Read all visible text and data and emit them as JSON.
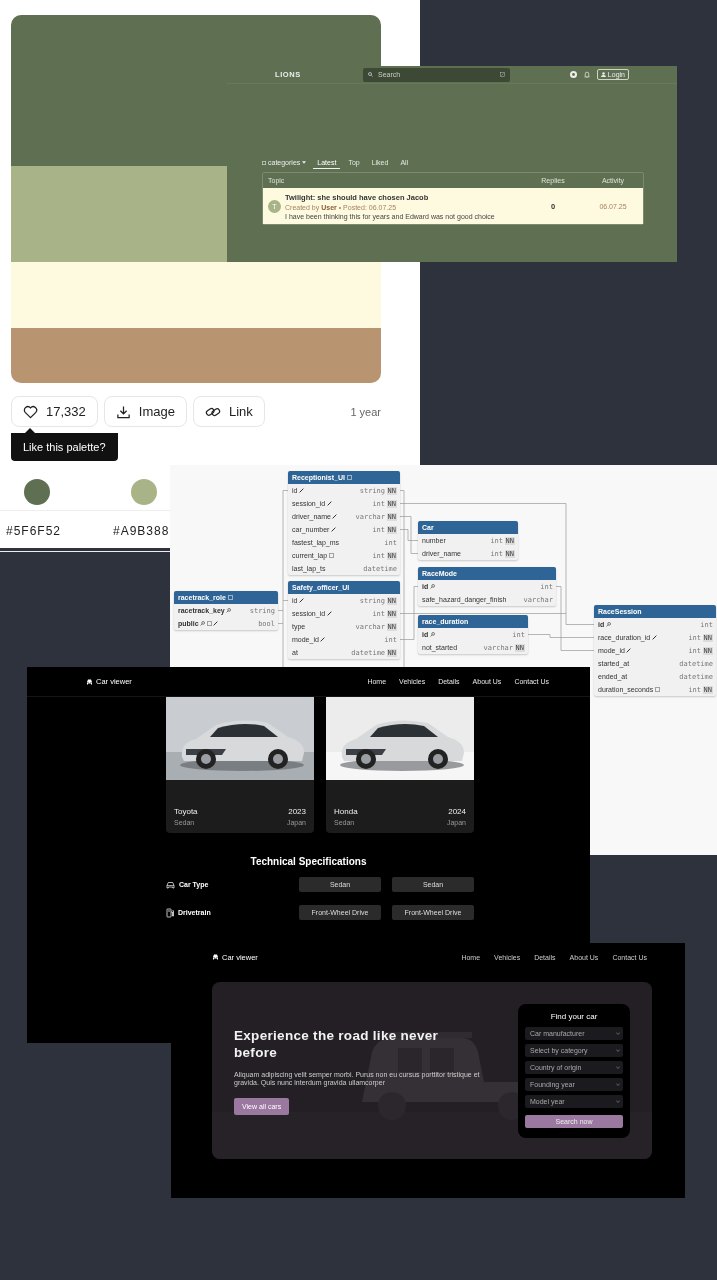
{
  "palette_card": {
    "swatches": [
      {
        "color": "#5F6F52"
      },
      {
        "color": "#A9B388"
      },
      {
        "color": "#FEFAE0"
      },
      {
        "color": "#B99470"
      }
    ],
    "like_count": "17,332",
    "buttons": [
      {
        "label": "Image",
        "kind": "download"
      },
      {
        "label": "Link",
        "kind": "link"
      }
    ],
    "age": "1 year",
    "tooltip": "Like this palette?",
    "colors": [
      {
        "color": "#5F6F52",
        "hex": "#5F6F52"
      },
      {
        "color": "#A9B388",
        "hex": "#A9B388"
      }
    ]
  },
  "forum": {
    "logo": "LIONS",
    "search_placeholder": "Search",
    "login": "Login",
    "categories": "categories",
    "tabs": [
      {
        "label": "Latest",
        "selected": true
      },
      {
        "label": "Top",
        "selected": false
      },
      {
        "label": "Liked",
        "selected": false
      },
      {
        "label": "All",
        "selected": false
      }
    ],
    "table": {
      "columns": [
        "Topic",
        "Replies",
        "Activity"
      ],
      "rows": [
        {
          "avatar": "T",
          "title": "Twilight: she should have chosen Jacob",
          "meta": "Created by **User** • Posted: 06.07.25",
          "excerpt": "I have been thinking this for years and Edward was not good choice",
          "replies": "0",
          "activity": "06.07.25"
        }
      ]
    }
  },
  "er_diagram": {
    "tables": [
      {
        "name": "Receptionist_UI",
        "kind": "noted",
        "fields": [
          {
            "name": "id",
            "type": "string",
            "constraint": "NN",
            "kind": "foreign"
          },
          {
            "name": "session_id",
            "type": "int",
            "constraint": "NN",
            "kind": "foreign"
          },
          {
            "name": "driver_name",
            "type": "varchar",
            "constraint": "NN",
            "kind": "foreign"
          },
          {
            "name": "car_number",
            "type": "int",
            "constraint": "NN",
            "kind": "foreign"
          },
          {
            "name": "fastest_lap_ms",
            "type": "int",
            "kind": "plain"
          },
          {
            "name": "current_lap",
            "type": "int",
            "constraint": "NN",
            "kind": "noted"
          },
          {
            "name": "last_lap_ts",
            "type": "datetime",
            "kind": "plain"
          }
        ]
      },
      {
        "name": "Car",
        "kind": "plain",
        "fields": [
          {
            "name": "number",
            "type": "int",
            "constraint": "NN",
            "kind": "plain"
          },
          {
            "name": "driver_name",
            "type": "int",
            "constraint": "NN",
            "kind": "plain"
          }
        ]
      },
      {
        "name": "racetrack_role",
        "kind": "noted",
        "fields": [
          {
            "name": "racetrack_key",
            "type": "string",
            "kind": "primary"
          },
          {
            "name": "public",
            "type": "bool",
            "kind": "primary-noted-foreign"
          }
        ]
      },
      {
        "name": "Safety_officer_UI",
        "kind": "plain",
        "fields": [
          {
            "name": "id",
            "type": "string",
            "constraint": "NN",
            "kind": "foreign"
          },
          {
            "name": "session_id",
            "type": "int",
            "constraint": "NN",
            "kind": "foreign"
          },
          {
            "name": "type",
            "type": "varchar",
            "constraint": "NN",
            "kind": "plain"
          },
          {
            "name": "mode_id",
            "type": "int",
            "kind": "foreign"
          },
          {
            "name": "at",
            "type": "datetime",
            "constraint": "NN",
            "kind": "plain"
          }
        ]
      },
      {
        "name": "RaceMode",
        "kind": "plain",
        "fields": [
          {
            "name": "id",
            "type": "int",
            "kind": "primary"
          },
          {
            "name": "safe_hazard_danger_finish",
            "type": "varchar",
            "kind": "plain"
          }
        ]
      },
      {
        "name": "race_duration",
        "kind": "plain",
        "fields": [
          {
            "name": "id",
            "type": "int",
            "kind": "primary"
          },
          {
            "name": "not_started",
            "type": "varchar",
            "constraint": "NN",
            "kind": "plain"
          }
        ]
      },
      {
        "name": "RaceSession",
        "kind": "plain",
        "fields": [
          {
            "name": "id",
            "type": "int",
            "kind": "primary"
          },
          {
            "name": "race_duration_id",
            "type": "int",
            "constraint": "NN",
            "kind": "foreign"
          },
          {
            "name": "mode_id",
            "type": "int",
            "constraint": "NN",
            "kind": "foreign"
          },
          {
            "name": "started_at",
            "type": "datetime",
            "kind": "plain"
          },
          {
            "name": "ended_at",
            "type": "datetime",
            "kind": "plain"
          },
          {
            "name": "duration_seconds",
            "type": "int",
            "constraint": "NN",
            "kind": "noted"
          }
        ]
      }
    ]
  },
  "car_viewer_details": {
    "brand": "Car viewer",
    "nav": [
      "Home",
      "Vehicles",
      "Details",
      "About Us",
      "Contact Us"
    ],
    "cars": [
      {
        "make": "Toyota",
        "year": "2023",
        "body": "Sedan",
        "country": "Japan"
      },
      {
        "make": "Honda",
        "year": "2024",
        "body": "Sedan",
        "country": "Japan"
      }
    ],
    "specs_title": "Technical Specifications",
    "specs": [
      {
        "label": "Car Type",
        "kind": "car",
        "values": [
          "Sedan",
          "Sedan"
        ]
      },
      {
        "label": "Drivetrain",
        "kind": "fuel",
        "values": [
          "Front-Wheel Drive",
          "Front-Wheel Drive"
        ]
      }
    ]
  },
  "car_viewer_home": {
    "brand": "Car viewer",
    "nav": [
      "Home",
      "Vehicles",
      "Details",
      "About Us",
      "Contact Us"
    ],
    "hero": {
      "heading": "Experience the road like never before",
      "text": "Aliquam adipiscing velit semper morbi. Purus non eu cursus porttitor tristique et gravida. Quis nunc interdum gravida ullamcorper",
      "button": "View all cars"
    },
    "finder": {
      "title": "Find your car",
      "selects": [
        "Car manufacturer",
        "Select by category",
        "Country of origin",
        "Founding year",
        "Model year"
      ],
      "button": "Search now"
    }
  }
}
